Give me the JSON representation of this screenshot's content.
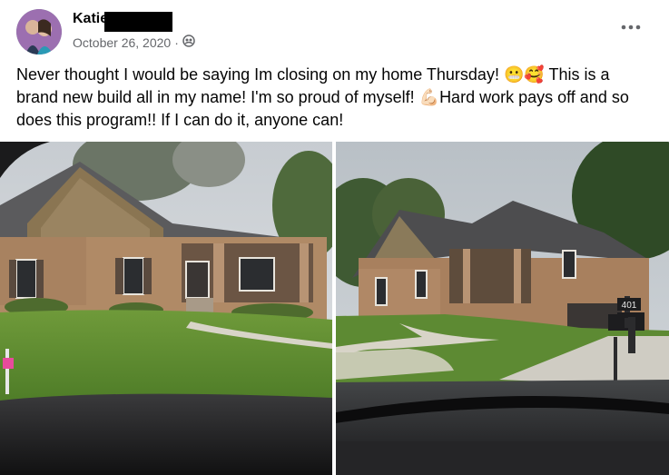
{
  "post": {
    "author_name": "Katie",
    "date": "October 26, 2020",
    "separator": "·",
    "audience_icon": "friends-audience-icon",
    "more_icon": "more-options-icon",
    "text_part1": "Never thought I would be saying Im closing on my home Thursday! ",
    "emoji1": "😬",
    "emoji2": "🥰",
    "text_part2": " This is a brand new build all in my name! I'm so proud of myself! ",
    "emoji3": "💪🏻",
    "text_part3": "Hard work pays off and so does this program!! If I can do it, anyone can!"
  },
  "photos": {
    "left": {
      "description_icon": "house-photo-left"
    },
    "right": {
      "mailbox_number": "401"
    }
  },
  "colors": {
    "author": "#050505",
    "meta": "#65676b",
    "background": "#ffffff"
  }
}
